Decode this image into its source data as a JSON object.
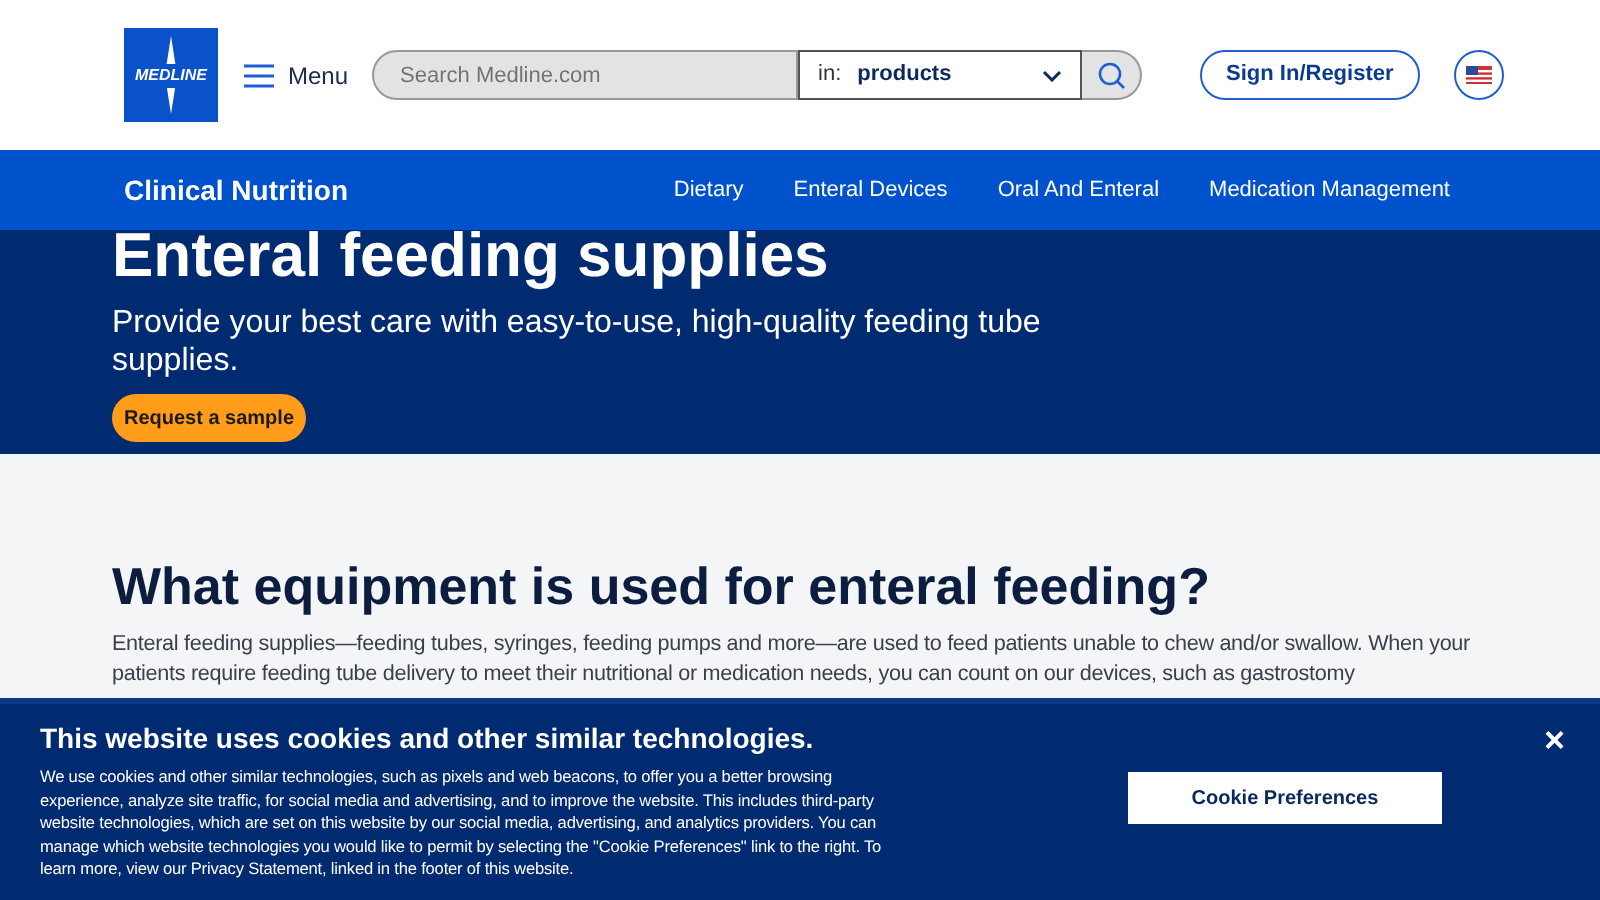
{
  "header": {
    "logo": "MEDLINE",
    "menu_label": "Menu",
    "search": {
      "placeholder": "Search Medline.com"
    },
    "scope": {
      "prefix": "in:",
      "value": "products"
    },
    "sign_in": "Sign In/Register"
  },
  "nav": {
    "title": "Clinical Nutrition",
    "links": [
      "Dietary",
      "Enteral Devices",
      "Oral And Enteral",
      "Medication Management"
    ]
  },
  "hero": {
    "title": "Enteral feeding supplies",
    "subtitle": "Provide your best care with easy-to-use, high-quality feeding tube supplies.",
    "button": "Request a sample"
  },
  "section": {
    "heading": "What equipment is used for enteral feeding?",
    "body": "Enteral feeding supplies—feeding tubes, syringes, feeding pumps and more—are used to feed patients unable to chew and/or swallow. When your patients require feeding tube delivery to meet their nutritional or medication needs, you can count on our devices, such as gastrostomy"
  },
  "cookie_banner": {
    "title": "This website uses cookies and other similar technologies.",
    "body": "We use cookies and other similar technologies, such as pixels and web beacons, to offer you a better browsing experience, analyze site traffic, for social media and advertising, and to improve the website. This includes third-party website technologies, which are set on this website by our social media, advertising, and analytics providers. You can manage which website technologies you would like to permit by selecting the \"Cookie Preferences\" link to the right. To learn more, view our Privacy Statement, linked in the footer of this website.",
    "button": "Cookie Preferences",
    "close": "×"
  }
}
